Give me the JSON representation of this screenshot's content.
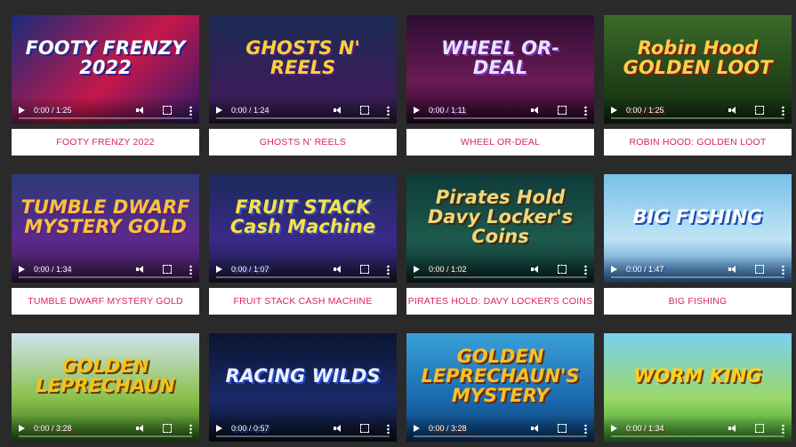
{
  "games": [
    {
      "title": "FOOTY FRENZY 2022",
      "art_text": "FOOTY FRENZY 2022",
      "time": "0:00 / 1:25"
    },
    {
      "title": "GHOSTS N' REELS",
      "art_text": "GHOSTS N' REELS",
      "time": "0:00 / 1:24"
    },
    {
      "title": "WHEEL OR-DEAL",
      "art_text": "WHEEL OR-DEAL",
      "time": "0:00 / 1:11"
    },
    {
      "title": "ROBIN HOOD: GOLDEN LOOT",
      "art_text": "Robin Hood GOLDEN LOOT",
      "time": "0:00 / 1:25"
    },
    {
      "title": "TUMBLE DWARF MYSTERY GOLD",
      "art_text": "TUMBLE DWARF MYSTERY GOLD",
      "time": "0:00 / 1:34"
    },
    {
      "title": "FRUIT STACK CASH MACHINE",
      "art_text": "FRUIT STACK Cash Machine",
      "time": "0:00 / 1:07"
    },
    {
      "title": "PIRATES HOLD: DAVY LOCKER'S COINS",
      "art_text": "Pirates Hold Davy Locker's Coins",
      "time": "0:00 / 1:02"
    },
    {
      "title": "BIG FISHING",
      "art_text": "BIG FISHING",
      "time": "0:00 / 1:47"
    },
    {
      "title": "",
      "art_text": "GOLDEN LEPRECHAUN",
      "time": "0:00 / 3:28"
    },
    {
      "title": "",
      "art_text": "RACING WILDS",
      "time": "0:00 / 0:57"
    },
    {
      "title": "",
      "art_text": "GOLDEN LEPRECHAUN'S MYSTERY",
      "time": "0:00 / 3:28"
    },
    {
      "title": "",
      "art_text": "WORM KING",
      "time": "0:00 / 1:34"
    }
  ],
  "colors": {
    "page_bg": "#2a2a2a",
    "label_text": "#d81f6c",
    "label_bg": "#ffffff"
  },
  "icons": [
    "play-icon",
    "volume-icon",
    "fullscreen-icon",
    "more-options-icon"
  ]
}
